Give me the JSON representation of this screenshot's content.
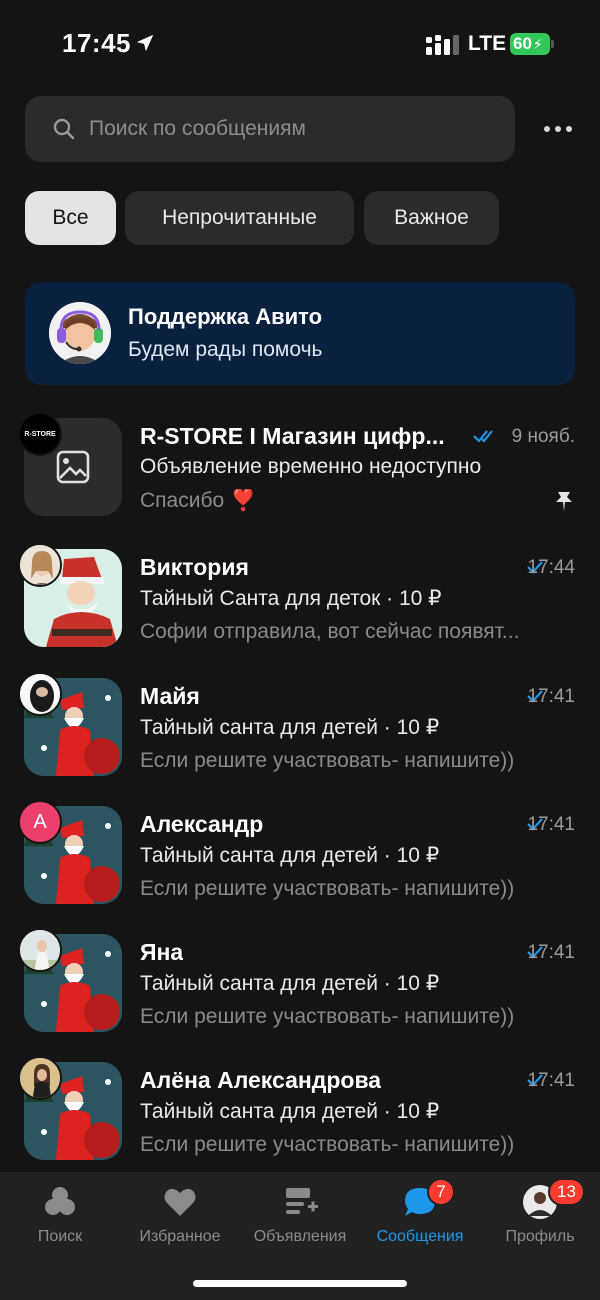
{
  "status": {
    "time": "17:45",
    "network": "LTE",
    "battery": "60"
  },
  "search": {
    "placeholder": "Поиск по сообщениям"
  },
  "filters": [
    "Все",
    "Непрочитанные",
    "Важное"
  ],
  "support": {
    "title": "Поддержка Авито",
    "subtitle": "Будем рады помочь"
  },
  "chats": [
    {
      "name": "R-STORE I Магазин цифр...",
      "date": "9 нояб.",
      "ad": "Объявление временно недоступно",
      "last": "Спасибо ❣️",
      "read": "double",
      "pinned": true,
      "mini_label": "R-STORE"
    },
    {
      "name": "Виктория",
      "date": "17:44",
      "ad": "Тайный Санта для деток · 10 ₽",
      "last": "Софии отправила, вот сейчас появят...",
      "read": "single",
      "pinned": false
    },
    {
      "name": "Майя",
      "date": "17:41",
      "ad": "Тайный санта для детей · 10 ₽",
      "last": "Если решите участвовать- напишите))",
      "read": "single",
      "pinned": false
    },
    {
      "name": "Александр",
      "date": "17:41",
      "ad": "Тайный санта для детей · 10 ₽",
      "last": "Если решите участвовать- напишите))",
      "read": "single",
      "pinned": false,
      "mini_label": "А"
    },
    {
      "name": "Яна",
      "date": "17:41",
      "ad": "Тайный санта для детей · 10 ₽",
      "last": "Если решите участвовать- напишите))",
      "read": "single",
      "pinned": false
    },
    {
      "name": "Алёна Александрова",
      "date": "17:41",
      "ad": "Тайный санта для детей · 10 ₽",
      "last": "Если решите участвовать- напишите))",
      "read": "single",
      "pinned": false
    }
  ],
  "tabs": [
    {
      "label": "Поиск",
      "icon": "search-circles-icon"
    },
    {
      "label": "Избранное",
      "icon": "heart-icon"
    },
    {
      "label": "Объявления",
      "icon": "ads-list-icon"
    },
    {
      "label": "Сообщения",
      "icon": "chat-bubble-icon",
      "badge": "7",
      "active": true
    },
    {
      "label": "Профиль",
      "icon": "profile-avatar-icon",
      "badge": "13"
    }
  ],
  "colors": {
    "accent": "#1e97e8",
    "badge": "#ff3b30",
    "support_bg": "#09203f",
    "battery": "#32c759"
  }
}
